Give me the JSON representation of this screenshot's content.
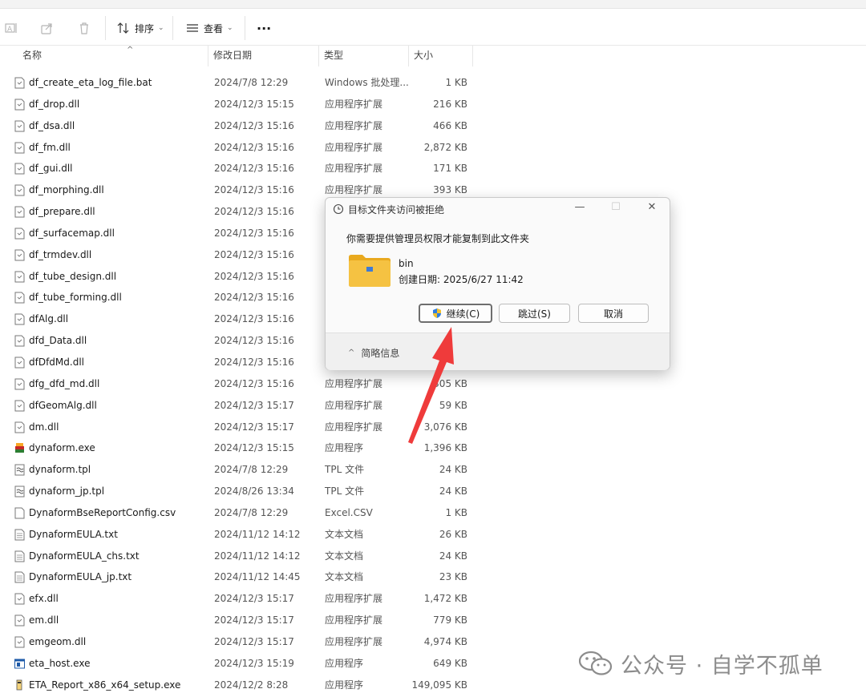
{
  "toolbar": {
    "sort_label": "排序",
    "view_label": "查看",
    "more_label": "···"
  },
  "columns": {
    "name": "名称",
    "date": "修改日期",
    "type": "类型",
    "size": "大小"
  },
  "files": [
    {
      "name": "df_create_eta_log_file.bat",
      "date": "2024/7/8 12:29",
      "type": "Windows 批处理...",
      "size": "1 KB",
      "icon": "bat-file-icon"
    },
    {
      "name": "df_drop.dll",
      "date": "2024/12/3 15:15",
      "type": "应用程序扩展",
      "size": "216 KB",
      "icon": "dll-file-icon"
    },
    {
      "name": "df_dsa.dll",
      "date": "2024/12/3 15:16",
      "type": "应用程序扩展",
      "size": "466 KB",
      "icon": "dll-file-icon"
    },
    {
      "name": "df_fm.dll",
      "date": "2024/12/3 15:16",
      "type": "应用程序扩展",
      "size": "2,872 KB",
      "icon": "dll-file-icon"
    },
    {
      "name": "df_gui.dll",
      "date": "2024/12/3 15:16",
      "type": "应用程序扩展",
      "size": "171 KB",
      "icon": "dll-file-icon"
    },
    {
      "name": "df_morphing.dll",
      "date": "2024/12/3 15:16",
      "type": "应用程序扩展",
      "size": "393 KB",
      "icon": "dll-file-icon"
    },
    {
      "name": "df_prepare.dll",
      "date": "2024/12/3 15:16",
      "type": "",
      "size": "",
      "icon": "dll-file-icon"
    },
    {
      "name": "df_surfacemap.dll",
      "date": "2024/12/3 15:16",
      "type": "",
      "size": "",
      "icon": "dll-file-icon"
    },
    {
      "name": "df_trmdev.dll",
      "date": "2024/12/3 15:16",
      "type": "",
      "size": "",
      "icon": "dll-file-icon"
    },
    {
      "name": "df_tube_design.dll",
      "date": "2024/12/3 15:16",
      "type": "",
      "size": "",
      "icon": "dll-file-icon"
    },
    {
      "name": "df_tube_forming.dll",
      "date": "2024/12/3 15:16",
      "type": "",
      "size": "",
      "icon": "dll-file-icon"
    },
    {
      "name": "dfAlg.dll",
      "date": "2024/12/3 15:16",
      "type": "",
      "size": "",
      "icon": "dll-file-icon"
    },
    {
      "name": "dfd_Data.dll",
      "date": "2024/12/3 15:16",
      "type": "",
      "size": "",
      "icon": "dll-file-icon"
    },
    {
      "name": "dfDfdMd.dll",
      "date": "2024/12/3 15:16",
      "type": "",
      "size": "",
      "icon": "dll-file-icon"
    },
    {
      "name": "dfg_dfd_md.dll",
      "date": "2024/12/3 15:16",
      "type": "应用程序扩展",
      "size": "305 KB",
      "icon": "dll-file-icon"
    },
    {
      "name": "dfGeomAlg.dll",
      "date": "2024/12/3 15:17",
      "type": "应用程序扩展",
      "size": "59 KB",
      "icon": "dll-file-icon"
    },
    {
      "name": "dm.dll",
      "date": "2024/12/3 15:17",
      "type": "应用程序扩展",
      "size": "3,076 KB",
      "icon": "dll-file-icon"
    },
    {
      "name": "dynaform.exe",
      "date": "2024/12/3 15:15",
      "type": "应用程序",
      "size": "1,396 KB",
      "icon": "dynaform-app-icon"
    },
    {
      "name": "dynaform.tpl",
      "date": "2024/7/8 12:29",
      "type": "TPL 文件",
      "size": "24 KB",
      "icon": "tpl-file-icon"
    },
    {
      "name": "dynaform_jp.tpl",
      "date": "2024/8/26 13:34",
      "type": "TPL 文件",
      "size": "24 KB",
      "icon": "tpl-file-icon"
    },
    {
      "name": "DynaformBseReportConfig.csv",
      "date": "2024/7/8 12:29",
      "type": "Excel.CSV",
      "size": "1 KB",
      "icon": "csv-file-icon"
    },
    {
      "name": "DynaformEULA.txt",
      "date": "2024/11/12 14:12",
      "type": "文本文档",
      "size": "26 KB",
      "icon": "txt-file-icon"
    },
    {
      "name": "DynaformEULA_chs.txt",
      "date": "2024/11/12 14:12",
      "type": "文本文档",
      "size": "24 KB",
      "icon": "txt-file-icon"
    },
    {
      "name": "DynaformEULA_jp.txt",
      "date": "2024/11/12 14:45",
      "type": "文本文档",
      "size": "23 KB",
      "icon": "txt-file-icon"
    },
    {
      "name": "efx.dll",
      "date": "2024/12/3 15:17",
      "type": "应用程序扩展",
      "size": "1,472 KB",
      "icon": "dll-file-icon"
    },
    {
      "name": "em.dll",
      "date": "2024/12/3 15:17",
      "type": "应用程序扩展",
      "size": "779 KB",
      "icon": "dll-file-icon"
    },
    {
      "name": "emgeom.dll",
      "date": "2024/12/3 15:17",
      "type": "应用程序扩展",
      "size": "4,974 KB",
      "icon": "dll-file-icon"
    },
    {
      "name": "eta_host.exe",
      "date": "2024/12/3 15:19",
      "type": "应用程序",
      "size": "649 KB",
      "icon": "exe-app-icon"
    },
    {
      "name": "ETA_Report_x86_x64_setup.exe",
      "date": "2024/12/2 8:28",
      "type": "应用程序",
      "size": "149,095 KB",
      "icon": "setup-app-icon"
    }
  ],
  "dialog": {
    "title": "目标文件夹访问被拒绝",
    "message": "你需要提供管理员权限才能复制到此文件夹",
    "folder_name": "bin",
    "folder_date": "创建日期: 2025/6/27 11:42",
    "continue_label": "继续(C)",
    "skip_label": "跳过(S)",
    "cancel_label": "取消",
    "details_label": "简略信息",
    "minimize": "—",
    "maximize": "☐",
    "close": "✕"
  },
  "watermark": {
    "text": "公众号 · 自学不孤单"
  },
  "colors": {
    "folder_yellow": "#f5c242",
    "arrow_red": "#ef3b3b",
    "dll_gray": "#8a8a8a"
  }
}
